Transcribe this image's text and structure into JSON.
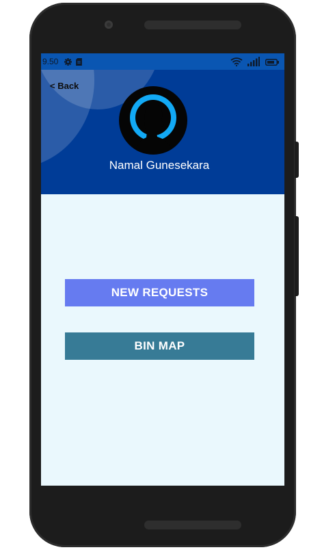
{
  "status_bar": {
    "time": "9.50",
    "icons": [
      "gear-icon",
      "sd-card-icon",
      "wifi-icon",
      "signal-icon",
      "battery-icon"
    ]
  },
  "header": {
    "back_label": "< Back",
    "user_name": "Namal Gunesekara",
    "avatar_icon": "person-silhouette-icon"
  },
  "actions": {
    "new_requests_label": "NEW REQUESTS",
    "bin_map_label": "BIN MAP"
  },
  "colors": {
    "header_bg": "#003c97",
    "status_bar_bg": "#0a56b2",
    "screen_bg": "#eaf8fd",
    "new_requests_bg": "#667bf0",
    "bin_map_bg": "#377b96",
    "avatar_accent": "#12a9f5"
  }
}
